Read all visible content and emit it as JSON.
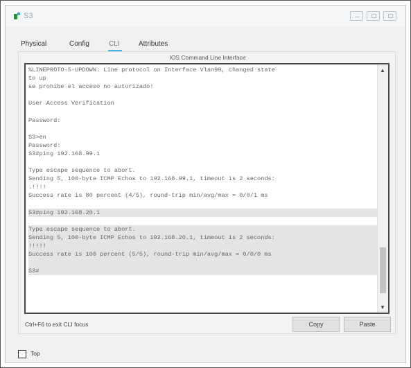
{
  "window": {
    "title": "S3",
    "controls": {
      "minimize": "minimize-icon",
      "restore": "restore-icon",
      "close": "close-icon"
    }
  },
  "tabs": [
    {
      "label": "Physical"
    },
    {
      "label": "Config"
    },
    {
      "label": "CLI",
      "active": true
    },
    {
      "label": "Attributes"
    }
  ],
  "cli": {
    "section_title": "IOS Command Line Interface",
    "lines": [
      {
        "text": "%LINEPROTO-5-UPDOWN: Line protocol on Interface Vlan99, changed state"
      },
      {
        "text": "to up"
      },
      {
        "text": "se prohibe el acceso no autorizado!"
      },
      {
        "text": ""
      },
      {
        "text": "User Access Verification"
      },
      {
        "text": ""
      },
      {
        "text": "Password:"
      },
      {
        "text": ""
      },
      {
        "text": "S3>en"
      },
      {
        "text": "Password:"
      },
      {
        "text": "S3#ping 192.168.99.1"
      },
      {
        "text": ""
      },
      {
        "text": "Type escape sequence to abort."
      },
      {
        "text": "Sending 5, 100-byte ICMP Echos to 192.168.99.1, timeout is 2 seconds:"
      },
      {
        "text": ".!!!!"
      },
      {
        "text": "Success rate is 80 percent (4/5), round-trip min/avg/max = 0/0/1 ms"
      },
      {
        "text": ""
      },
      {
        "text": "S3#ping 192.168.20.1",
        "highlight": true
      },
      {
        "text": ""
      },
      {
        "text": "Type escape sequence to abort.",
        "highlight": true
      },
      {
        "text": "Sending 5, 100-byte ICMP Echos to 192.168.20.1, timeout is 2 seconds:",
        "highlight": true
      },
      {
        "text": "!!!!!",
        "highlight": true
      },
      {
        "text": "Success rate is 100 percent (5/5), round-trip min/avg/max = 0/0/0 ms",
        "highlight": true
      },
      {
        "text": "",
        "highlight": true
      },
      {
        "text": "S3#",
        "highlight": true
      }
    ],
    "hint": "Ctrl+F6 to exit CLI focus",
    "copy_label": "Copy",
    "paste_label": "Paste"
  },
  "footer": {
    "top_label": "Top",
    "top_checked": false
  }
}
